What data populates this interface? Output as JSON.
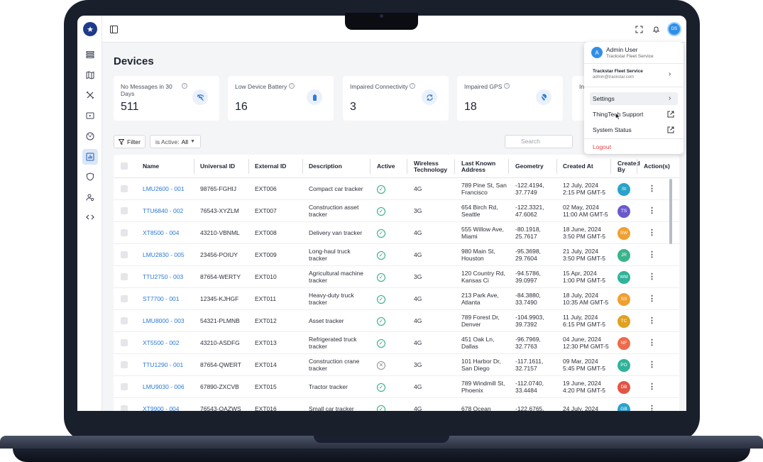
{
  "header": {
    "page_title": "Devices",
    "user_initials": "DS"
  },
  "summary_cards": [
    {
      "label": "No Messages in 30 Days",
      "value": "511",
      "icon": "wifi-off-icon"
    },
    {
      "label": "Low Device Battery",
      "value": "16",
      "icon": "battery-icon"
    },
    {
      "label": "Impaired Connectivity",
      "value": "3",
      "icon": "sync-icon"
    },
    {
      "label": "Impaired GPS",
      "value": "18",
      "icon": "location-off-icon"
    },
    {
      "label": "In",
      "value": "",
      "icon": ""
    }
  ],
  "toolbar": {
    "filter_label": "Filter",
    "active_filter_prefix": "is Active:",
    "active_filter_value": "All",
    "search_placeholder": "Search"
  },
  "table": {
    "columns": [
      "Name",
      "Universal ID",
      "External ID",
      "Description",
      "Active",
      "Wireless Technology",
      "Last Known Address",
      "Geometry",
      "Created At",
      "Created By",
      "Action(s)"
    ],
    "rows": [
      {
        "name": "LMU2600 - 001",
        "uid": "98765-FGHIJ",
        "eid": "EXT006",
        "desc": "Compact car tracker",
        "active": true,
        "tech": "4G",
        "addr": "789 Pine St, San Francisco",
        "geo": "-122.4194, 37.7749",
        "created": "12 July, 2024 2:15 PM GMT-5",
        "by": "St",
        "by_color": "#29a3c9"
      },
      {
        "name": "TTU6840 - 002",
        "uid": "76543-XYZLM",
        "eid": "EXT007",
        "desc": "Construction asset tracker",
        "active": true,
        "tech": "3G",
        "addr": "654 Birch Rd, Seattle",
        "geo": "-122.3321, 47.6062",
        "created": "02 May, 2024 11:00 AM GMT-5",
        "by": "TS",
        "by_color": "#6a5acd"
      },
      {
        "name": "XT8500 - 004",
        "uid": "43210-VBNML",
        "eid": "EXT008",
        "desc": "Delivery van tracker",
        "active": true,
        "tech": "4G",
        "addr": "555 Willow Ave, Miami",
        "geo": "-80.1918, 25.7617",
        "created": "18 June, 2024 3:50 PM GMT-5",
        "by": "SW",
        "by_color": "#f0a030"
      },
      {
        "name": "LMU2830 - 005",
        "uid": "23456-POIUY",
        "eid": "EXT009",
        "desc": "Long-haul truck tracker",
        "active": true,
        "tech": "4G",
        "addr": "980 Main St, Houston",
        "geo": "-95.3698, 29.7604",
        "created": "21 July, 2024 3:50 PM GMT-5",
        "by": "JR",
        "by_color": "#3bb38a"
      },
      {
        "name": "TTU2750 - 003",
        "uid": "87654-WERTY",
        "eid": "EXT010",
        "desc": "Agricultural machine tracker",
        "active": true,
        "tech": "3G",
        "addr": "120 Country Rd, Kansas Ci",
        "geo": "-94.5786, 39.0997",
        "created": "15 Apr, 2024 1:00 PM GMT-5",
        "by": "WM",
        "by_color": "#2fb39a"
      },
      {
        "name": "ST7700 - 001",
        "uid": "12345-KJHGF",
        "eid": "EXT011",
        "desc": "Heavy-duty truck tracker",
        "active": true,
        "tech": "4G",
        "addr": "213 Park Ave, Atlanta",
        "geo": "-84.3880, 33.7490",
        "created": "18 July, 2024 10:35 AM GMT-5",
        "by": "SS",
        "by_color": "#f0a030"
      },
      {
        "name": "LMU8000 - 003",
        "uid": "54321-PLMNB",
        "eid": "EXT012",
        "desc": "Asset tracker",
        "active": true,
        "tech": "4G",
        "addr": "789 Forest Dr, Denver",
        "geo": "-104.9903, 39.7392",
        "created": "11 July, 2024 6:15 PM GMT-5",
        "by": "TC",
        "by_color": "#e0a020"
      },
      {
        "name": "XT5500 - 002",
        "uid": "43210-ASDFG",
        "eid": "EXT013",
        "desc": "Refrigerated truck tracker",
        "active": true,
        "tech": "4G",
        "addr": "451 Oak Ln, Dallas",
        "geo": "-96.7969, 32.7763",
        "created": "04 June, 2024 12:30 PM GMT-5",
        "by": "NF",
        "by_color": "#ee6a4a"
      },
      {
        "name": "TTU1290 - 001",
        "uid": "87654-QWERT",
        "eid": "EXT014",
        "desc": "Construction crane tracker",
        "active": false,
        "tech": "3G",
        "addr": "101 Harbor Dr, San Diego",
        "geo": "-117.1611, 32.7157",
        "created": "09 Mar, 2024 5:45 PM GMT-5",
        "by": "PO",
        "by_color": "#2fb39a"
      },
      {
        "name": "LMU9030 - 006",
        "uid": "67890-ZXCVB",
        "eid": "EXT015",
        "desc": "Tractor tracker",
        "active": true,
        "tech": "4G",
        "addr": "789 Windmill St, Phoenix",
        "geo": "-112.0740, 33.4484",
        "created": "19 June, 2024 4:20 PM GMT-5",
        "by": "DB",
        "by_color": "#e25545"
      },
      {
        "name": "XT9900 - 004",
        "uid": "76543-QAZWS",
        "eid": "EXT016",
        "desc": "Small car tracker",
        "active": true,
        "tech": "4G",
        "addr": "678 Ocean",
        "geo": "-122.6765,",
        "created": "24 July, 2024",
        "by": "GB",
        "by_color": "#29a3c9"
      }
    ]
  },
  "user_menu": {
    "avatar_letter": "A",
    "user_name": "Admin User",
    "org_name": "Trackstar Fleet Service",
    "account_org": "Trackstar Fleet Service",
    "account_email": "admin@trackstar.com",
    "items": [
      "Settings",
      "ThingTech Support",
      "System Status"
    ],
    "logout": "Logout"
  }
}
